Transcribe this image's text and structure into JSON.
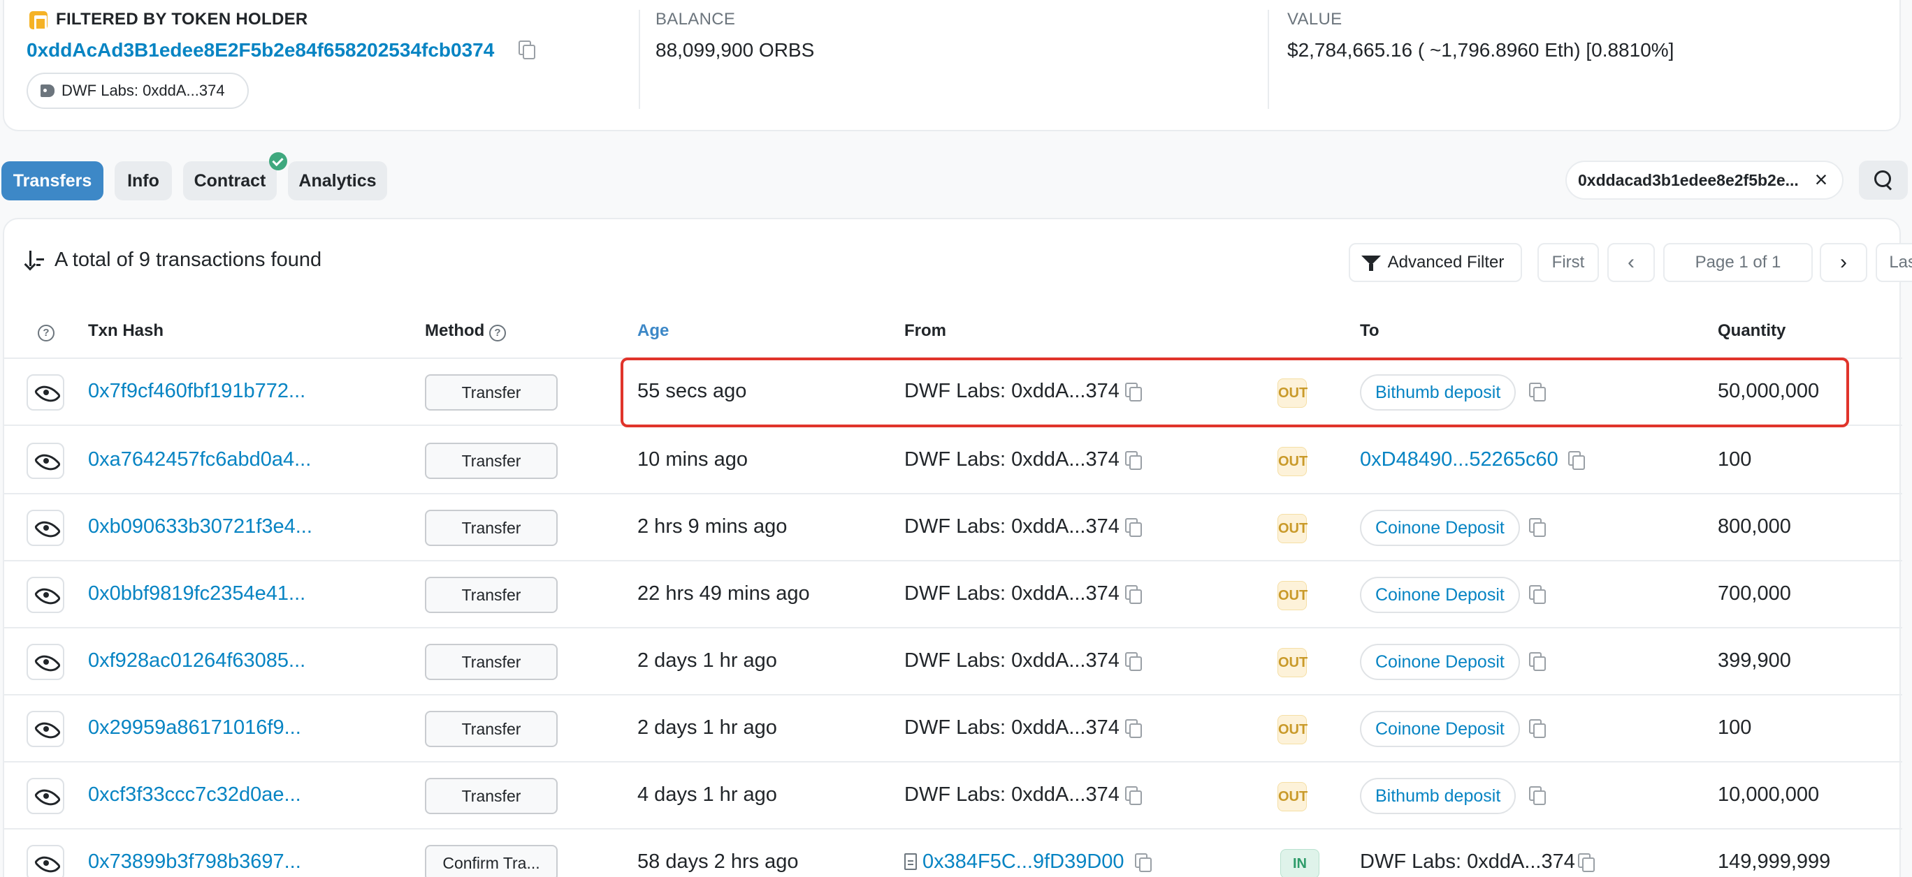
{
  "summary": {
    "holder_label": "FILTERED BY TOKEN HOLDER",
    "holder_address": "0xddAcAd3B1edee8E2F5b2e84f658202534fcb0374",
    "holder_tag": "DWF Labs: 0xddA...374",
    "balance_label": "BALANCE",
    "balance_value": "88,099,900 ORBS",
    "value_label": "VALUE",
    "value_value": "$2,784,665.16 ( ~1,796.8960 Eth) [0.8810%]"
  },
  "tabs": [
    {
      "label": "Transfers",
      "active": true
    },
    {
      "label": "Info",
      "active": false
    },
    {
      "label": "Contract",
      "active": false
    },
    {
      "label": "Analytics",
      "active": false
    }
  ],
  "filter_chip": {
    "value": "0xddacad3b1edee8e2f5b2e...",
    "close": "×"
  },
  "toolbar": {
    "total_text": "A total of 9 transactions found",
    "advanced_filter": "Advanced Filter",
    "first": "First",
    "prev": "‹",
    "page": "Page 1 of 1",
    "next": "›",
    "last": "Last"
  },
  "columns": {
    "help": "?",
    "txn_hash": "Txn Hash",
    "method": "Method",
    "age": "Age",
    "from": "From",
    "to": "To",
    "quantity": "Quantity"
  },
  "rows": [
    {
      "hash": "0x7f9cf460fbf191b772...",
      "method": "Transfer",
      "age": "55 secs ago",
      "from": "DWF Labs: 0xddA...374",
      "dir": "OUT",
      "to": "Bithumb deposit",
      "qty": "50,000,000"
    },
    {
      "hash": "0xa7642457fc6abd0a4...",
      "method": "Transfer",
      "age": "10 mins ago",
      "from": "DWF Labs: 0xddA...374",
      "dir": "OUT",
      "to": "0xD48490...52265c60",
      "qty": "100"
    },
    {
      "hash": "0xb090633b30721f3e4...",
      "method": "Transfer",
      "age": "2 hrs 9 mins ago",
      "from": "DWF Labs: 0xddA...374",
      "dir": "OUT",
      "to": "Coinone Deposit",
      "qty": "800,000"
    },
    {
      "hash": "0x0bbf9819fc2354e41...",
      "method": "Transfer",
      "age": "22 hrs 49 mins ago",
      "from": "DWF Labs: 0xddA...374",
      "dir": "OUT",
      "to": "Coinone Deposit",
      "qty": "700,000"
    },
    {
      "hash": "0xf928ac01264f63085...",
      "method": "Transfer",
      "age": "2 days 1 hr ago",
      "from": "DWF Labs: 0xddA...374",
      "dir": "OUT",
      "to": "Coinone Deposit",
      "qty": "399,900"
    },
    {
      "hash": "0x29959a86171016f9...",
      "method": "Transfer",
      "age": "2 days 1 hr ago",
      "from": "DWF Labs: 0xddA...374",
      "dir": "OUT",
      "to": "Coinone Deposit",
      "qty": "100"
    },
    {
      "hash": "0xcf3f33ccc7c32d0ae...",
      "method": "Transfer",
      "age": "4 days 1 hr ago",
      "from": "DWF Labs: 0xddA...374",
      "dir": "OUT",
      "to": "Bithumb deposit",
      "qty": "10,000,000"
    },
    {
      "hash": "0x73899b3f798b3697...",
      "method": "Confirm Tra...",
      "age": "58 days 2 hrs ago",
      "from": "0x384F5C...9fD39D00",
      "dir": "IN",
      "to": "DWF Labs: 0xddA...374",
      "qty": "149,999,999"
    }
  ],
  "colors": {
    "link": "#0784c3",
    "active_tab": "#3d88c7",
    "highlight": "#e0342b",
    "out_badge": "#c99a2a",
    "in_badge": "#2e9c6a"
  }
}
